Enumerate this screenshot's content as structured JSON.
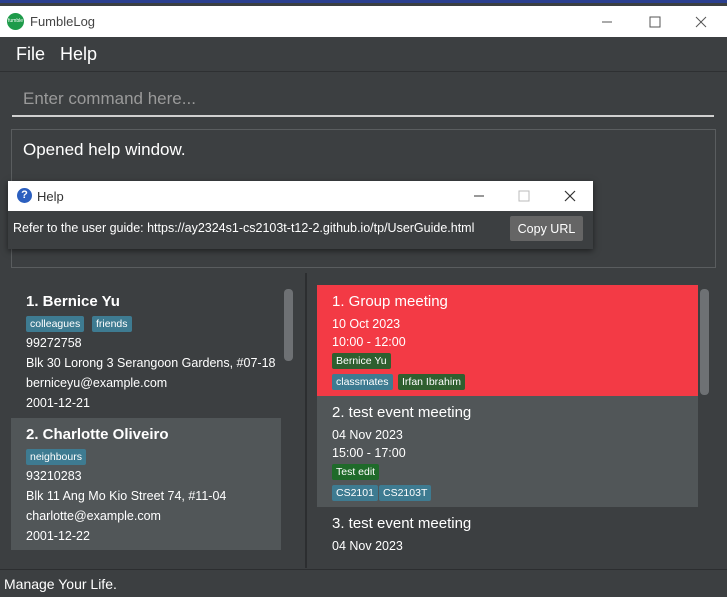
{
  "window": {
    "title": "FumbleLog",
    "icon_label": "fumble",
    "controls": [
      "minimize-icon",
      "maximize-icon",
      "close-icon"
    ]
  },
  "menu": {
    "file_label": "File",
    "help_label": "Help"
  },
  "command_box": {
    "placeholder": "Enter command here...",
    "value": ""
  },
  "result_display": {
    "text": "Opened help window."
  },
  "help_window": {
    "title": "Help",
    "message": "Refer to the user guide: https://ay2324s1-cs2103t-t12-2.github.io/tp/UserGuide.html",
    "copy_button_label": "Copy URL"
  },
  "persons": [
    {
      "index_name": "1.  Bernice Yu",
      "tags": [
        "colleagues",
        "friends"
      ],
      "phone": "99272758",
      "address": "Blk 30 Lorong 3 Serangoon Gardens, #07-18",
      "email": "berniceyu@example.com",
      "birthday": "2001-12-21"
    },
    {
      "index_name": "2.  Charlotte Oliveiro",
      "tags": [
        "neighbours"
      ],
      "phone": "93210283",
      "address": "Blk 11 Ang Mo Kio Street 74, #11-04",
      "email": "charlotte@example.com",
      "birthday": "2001-12-22"
    }
  ],
  "events": [
    {
      "index_name": "1.  Group meeting",
      "date": "10 Oct 2023",
      "time": "10:00 - 12:00",
      "persons": [
        "Bernice Yu"
      ],
      "groups": [
        "classmates"
      ],
      "extra_persons": [
        "Irfan Ibrahim"
      ]
    },
    {
      "index_name": "2.  test event meeting",
      "date": "04 Nov 2023",
      "time": "15:00 - 17:00",
      "persons": [
        "Test edit"
      ],
      "groups": [
        "CS2101",
        "CS2103T"
      ]
    },
    {
      "index_name": "3.  test event meeting",
      "date": "04 Nov 2023"
    }
  ],
  "status_bar": {
    "text": "Manage Your Life."
  },
  "colors": {
    "background": "#3c3f41",
    "selected_event": "#f33a45",
    "alt_card": "#515658",
    "tag_blue": "#3e7b91",
    "tag_green": "#2f5f2f"
  }
}
